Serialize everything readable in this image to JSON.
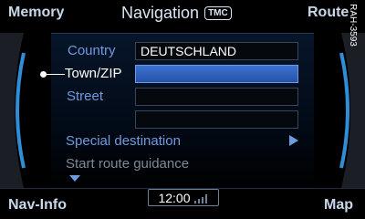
{
  "softkeys": {
    "top_left": "Memory",
    "top_right": "Route",
    "bottom_left": "Nav-Info",
    "bottom_right": "Map"
  },
  "header": {
    "title": "Navigation",
    "badge": "TMC"
  },
  "reference_code": "RAH-3593",
  "form": {
    "country_label": "Country",
    "country_value": "DEUTSCHLAND",
    "town_label": "Town/ZIP",
    "town_value": "",
    "street_label": "Street",
    "street_value": "",
    "extra_value": ""
  },
  "menu": {
    "special_destination": "Special destination",
    "start_route_guidance": "Start route guidance"
  },
  "status": {
    "time": "12:00"
  },
  "colors": {
    "accent_blue": "#6f9be0",
    "selected_field": "#2f62c2",
    "disabled_text": "#7f8896"
  },
  "icons": {
    "selection_bullet": "bullet-dot",
    "submenu": "play-triangle",
    "scroll": "down-triangle",
    "signal": "signal-bars"
  }
}
